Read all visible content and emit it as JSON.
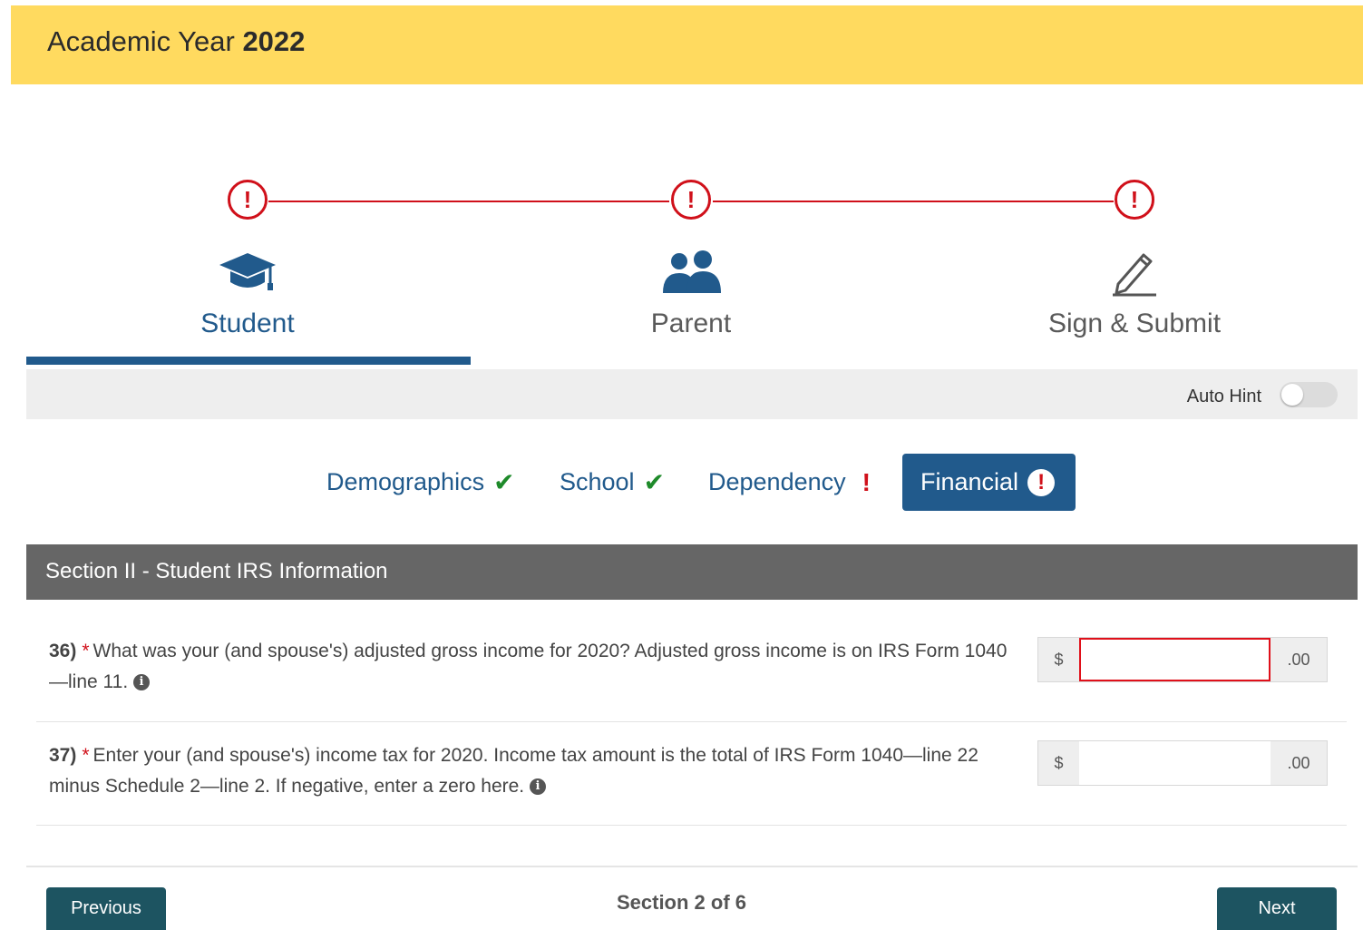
{
  "header": {
    "title_prefix": "Academic Year",
    "title_year": "2022"
  },
  "steps": [
    {
      "label": "Student",
      "icon": "graduation-cap-icon",
      "status": "!"
    },
    {
      "label": "Parent",
      "icon": "users-icon",
      "status": "!"
    },
    {
      "label": "Sign & Submit",
      "icon": "pencil-icon",
      "status": "!"
    }
  ],
  "auto_hint": {
    "label": "Auto Hint",
    "enabled": false
  },
  "subnav": [
    {
      "label": "Demographics",
      "status": "✔"
    },
    {
      "label": "School",
      "status": "✔"
    },
    {
      "label": "Dependency",
      "status": "!"
    },
    {
      "label": "Financial",
      "status": "!"
    }
  ],
  "section": {
    "title": "Section II - Student IRS Information"
  },
  "questions": [
    {
      "number": "36)",
      "required": "*",
      "text": "What was your (and spouse's) adjusted gross income for 2020? Adjusted gross income is on IRS Form 1040—line 11.",
      "info": "i",
      "prefix": "$",
      "suffix": ".00",
      "value": ""
    },
    {
      "number": "37)",
      "required": "*",
      "text": "Enter your (and spouse's) income tax for 2020. Income tax amount is the total of IRS Form 1040—line 22 minus Schedule 2—line 2. If negative, enter a zero here.",
      "info": "i",
      "prefix": "$",
      "suffix": ".00",
      "value": ""
    }
  ],
  "footer": {
    "previous": "Previous",
    "position": "Section 2 of 6",
    "next": "Next"
  },
  "colors": {
    "accent": "#215a8c",
    "alert": "#d0101a",
    "header_bg": "#ffda5f",
    "section_bg": "#666666",
    "button_bg": "#1d5461"
  }
}
